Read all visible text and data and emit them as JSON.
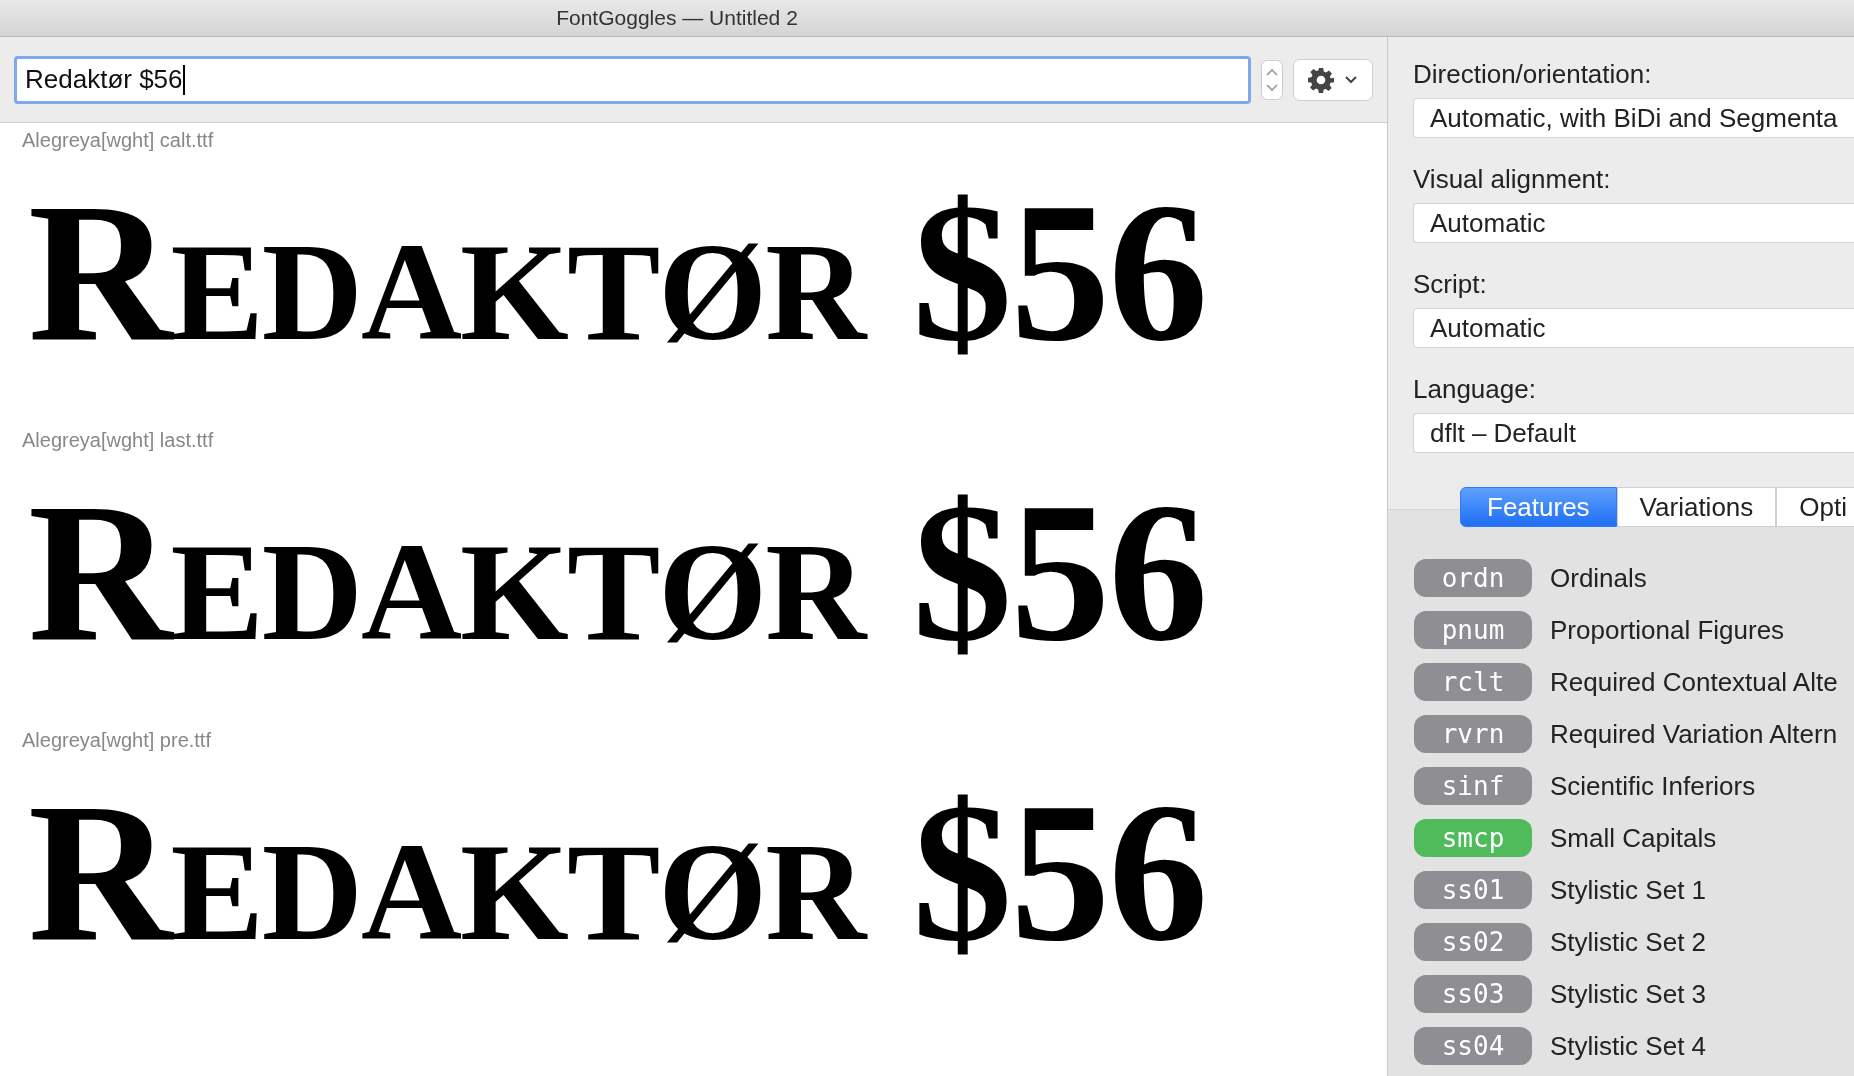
{
  "window": {
    "title": "FontGoggles — Untitled 2"
  },
  "toolbar": {
    "text_field": {
      "value": "Redaktør $56"
    }
  },
  "samples": [
    {
      "file": "Alegreya[wght] calt.ttf",
      "text": "Redaktør $56"
    },
    {
      "file": "Alegreya[wght] last.ttf",
      "text": "Redaktør $56"
    },
    {
      "file": "Alegreya[wght] pre.ttf",
      "text": "Redaktør $56"
    }
  ],
  "settings": [
    {
      "label": "Direction/orientation:",
      "value": "Automatic, with BiDi and Segmenta"
    },
    {
      "label": "Visual alignment:",
      "value": "Automatic"
    },
    {
      "label": "Script:",
      "value": "Automatic"
    },
    {
      "label": "Language:",
      "value": "dflt – Default"
    }
  ],
  "tabs": [
    {
      "label": "Features",
      "selected": true
    },
    {
      "label": "Variations",
      "selected": false
    },
    {
      "label": "Opti",
      "selected": false
    }
  ],
  "features": [
    {
      "tag": "ordn",
      "name": "Ordinals",
      "on": false
    },
    {
      "tag": "pnum",
      "name": "Proportional Figures",
      "on": false
    },
    {
      "tag": "rclt",
      "name": "Required Contextual Alte",
      "on": false
    },
    {
      "tag": "rvrn",
      "name": "Required Variation Altern",
      "on": false
    },
    {
      "tag": "sinf",
      "name": "Scientific Inferiors",
      "on": false
    },
    {
      "tag": "smcp",
      "name": "Small Capitals",
      "on": true
    },
    {
      "tag": "ss01",
      "name": "Stylistic Set 1",
      "on": false
    },
    {
      "tag": "ss02",
      "name": "Stylistic Set 2",
      "on": false
    },
    {
      "tag": "ss03",
      "name": "Stylistic Set 3",
      "on": false
    },
    {
      "tag": "ss04",
      "name": "Stylistic Set 4",
      "on": false
    }
  ]
}
